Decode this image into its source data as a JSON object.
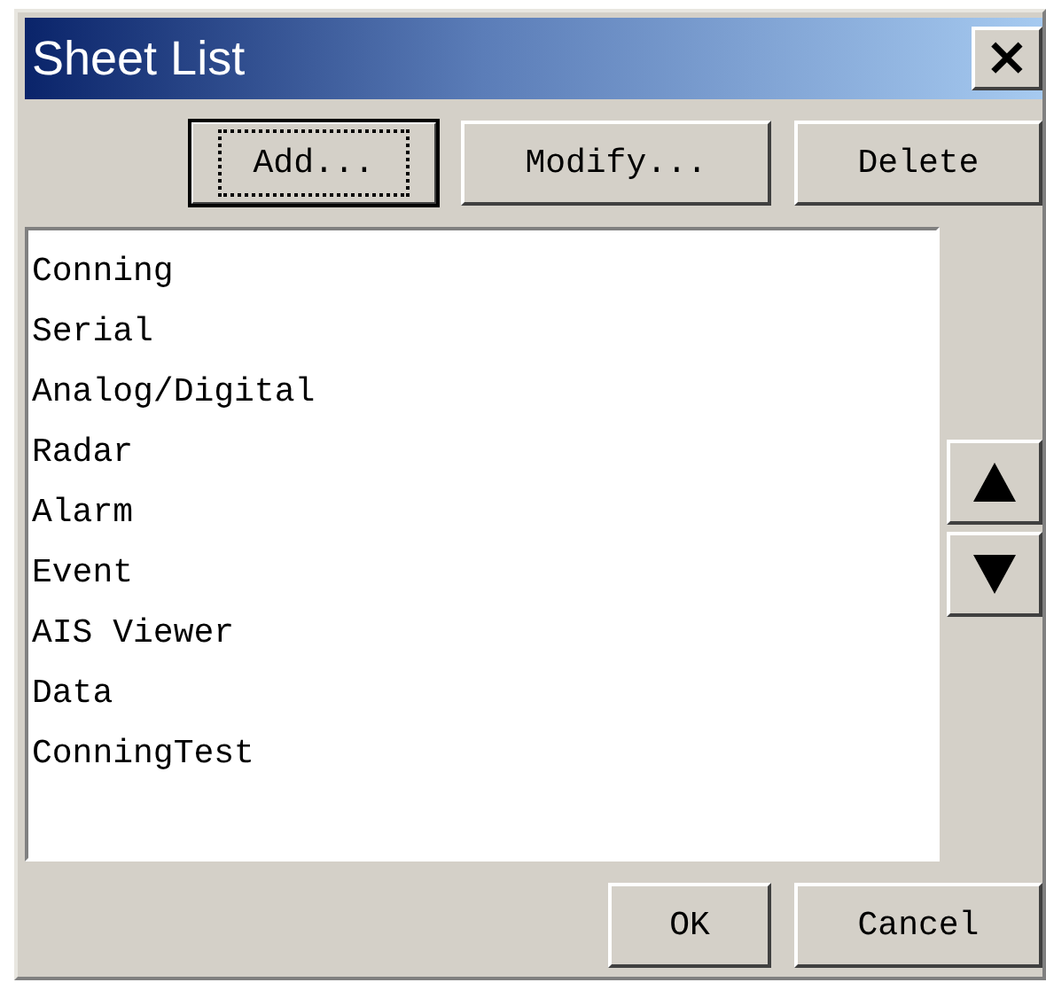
{
  "window": {
    "title": "Sheet List",
    "close": "×"
  },
  "top_buttons": [
    {
      "label": "Add...",
      "default": true
    },
    {
      "label": "Modify...",
      "default": false
    },
    {
      "label": "Delete",
      "default": false
    }
  ],
  "sheets": [
    "Conning",
    "Serial",
    "Analog/Digital",
    "Radar",
    "Alarm",
    "Event",
    "AIS Viewer",
    "Data",
    "ConningTest"
  ],
  "bottom_buttons": [
    {
      "label": "OK",
      "default": false
    },
    {
      "label": "Cancel",
      "default": false
    }
  ]
}
